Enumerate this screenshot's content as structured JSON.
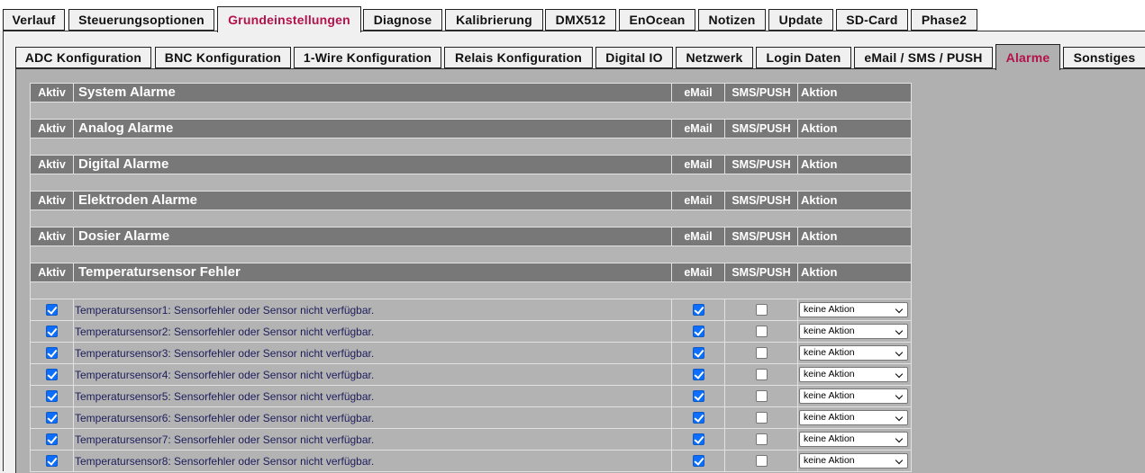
{
  "main_tabs": [
    {
      "label": "Verlauf",
      "active": false
    },
    {
      "label": "Steuerungsoptionen",
      "active": false
    },
    {
      "label": "Grundeinstellungen",
      "active": true
    },
    {
      "label": "Diagnose",
      "active": false
    },
    {
      "label": "Kalibrierung",
      "active": false
    },
    {
      "label": "DMX512",
      "active": false
    },
    {
      "label": "EnOcean",
      "active": false
    },
    {
      "label": "Notizen",
      "active": false
    },
    {
      "label": "Update",
      "active": false
    },
    {
      "label": "SD-Card",
      "active": false
    },
    {
      "label": "Phase2",
      "active": false
    }
  ],
  "sub_tabs": [
    {
      "label": "ADC Konfiguration",
      "active": false
    },
    {
      "label": "BNC Konfiguration",
      "active": false
    },
    {
      "label": "1-Wire Konfiguration",
      "active": false
    },
    {
      "label": "Relais Konfiguration",
      "active": false
    },
    {
      "label": "Digital IO",
      "active": false
    },
    {
      "label": "Netzwerk",
      "active": false
    },
    {
      "label": "Login Daten",
      "active": false
    },
    {
      "label": "eMail / SMS / PUSH",
      "active": false
    },
    {
      "label": "Alarme",
      "active": true
    },
    {
      "label": "Sonstiges",
      "active": false
    }
  ],
  "columns": {
    "active": "Aktiv",
    "email": "eMail",
    "sms": "SMS/PUSH",
    "action": "Aktion"
  },
  "sections": [
    {
      "title": "System Alarme",
      "rows": []
    },
    {
      "title": "Analog Alarme",
      "rows": []
    },
    {
      "title": "Digital Alarme",
      "rows": []
    },
    {
      "title": "Elektroden Alarme",
      "rows": []
    },
    {
      "title": "Dosier Alarme",
      "rows": []
    },
    {
      "title": "Temperatursensor Fehler",
      "rows": [
        {
          "active": true,
          "text": "Temperatursensor1: Sensorfehler oder Sensor nicht verfügbar.",
          "email": true,
          "sms": false,
          "action": "keine Aktion"
        },
        {
          "active": true,
          "text": "Temperatursensor2: Sensorfehler oder Sensor nicht verfügbar.",
          "email": true,
          "sms": false,
          "action": "keine Aktion"
        },
        {
          "active": true,
          "text": "Temperatursensor3: Sensorfehler oder Sensor nicht verfügbar.",
          "email": true,
          "sms": false,
          "action": "keine Aktion"
        },
        {
          "active": true,
          "text": "Temperatursensor4: Sensorfehler oder Sensor nicht verfügbar.",
          "email": true,
          "sms": false,
          "action": "keine Aktion"
        },
        {
          "active": true,
          "text": "Temperatursensor5: Sensorfehler oder Sensor nicht verfügbar.",
          "email": true,
          "sms": false,
          "action": "keine Aktion"
        },
        {
          "active": true,
          "text": "Temperatursensor6: Sensorfehler oder Sensor nicht verfügbar.",
          "email": true,
          "sms": false,
          "action": "keine Aktion"
        },
        {
          "active": true,
          "text": "Temperatursensor7: Sensorfehler oder Sensor nicht verfügbar.",
          "email": true,
          "sms": false,
          "action": "keine Aktion"
        },
        {
          "active": true,
          "text": "Temperatursensor8: Sensorfehler oder Sensor nicht verfügbar.",
          "email": true,
          "sms": false,
          "action": "keine Aktion"
        }
      ]
    }
  ]
}
